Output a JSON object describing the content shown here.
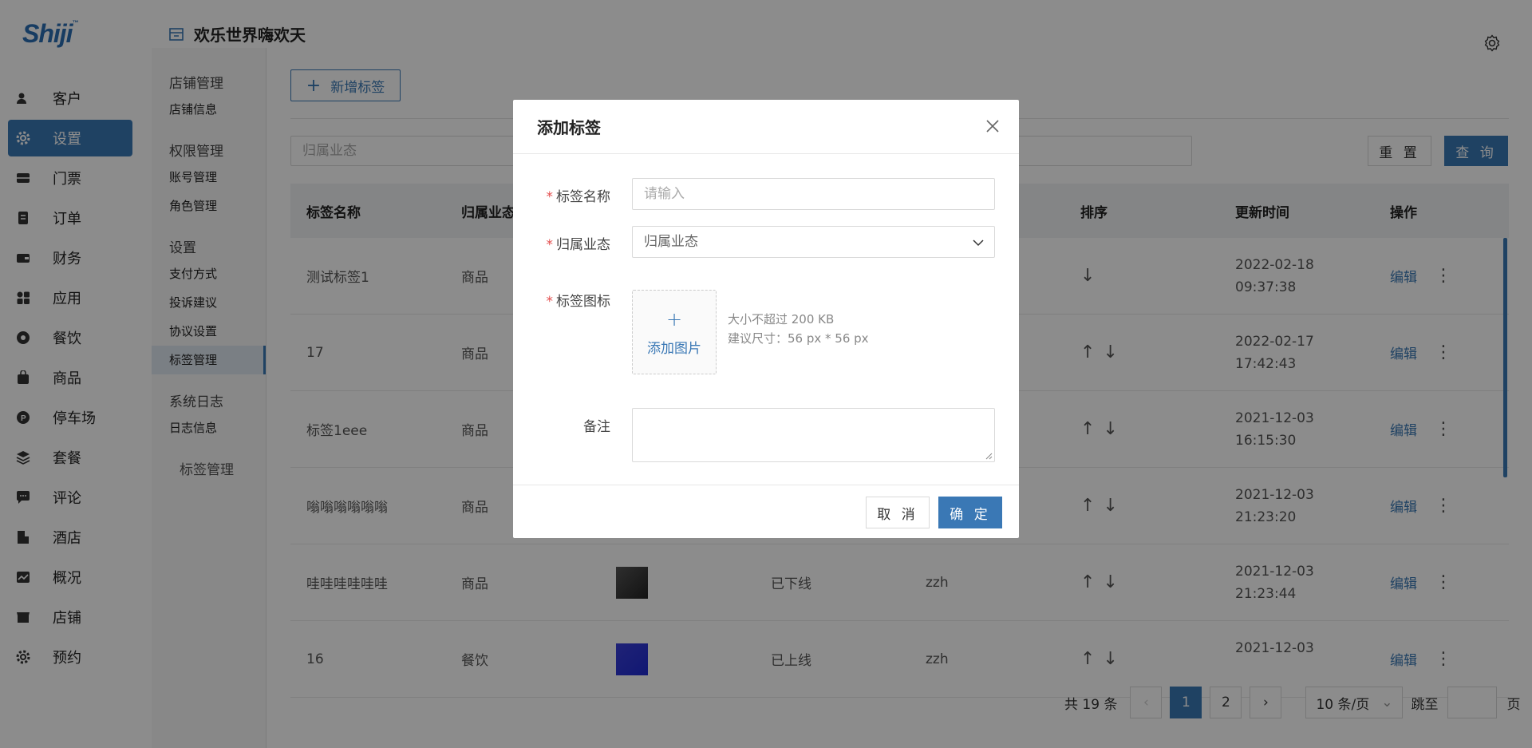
{
  "app": {
    "logo": "Shiji",
    "logo_mark": "™",
    "store_name": "欢乐世界嗨欢天"
  },
  "sidebar": {
    "items": [
      {
        "label": "客户",
        "icon": "user-icon"
      },
      {
        "label": "设置",
        "icon": "gear-icon",
        "active": true
      },
      {
        "label": "门票",
        "icon": "ticket-icon"
      },
      {
        "label": "订单",
        "icon": "order-icon"
      },
      {
        "label": "财务",
        "icon": "wallet-icon"
      },
      {
        "label": "应用",
        "icon": "apps-icon"
      },
      {
        "label": "餐饮",
        "icon": "dining-icon"
      },
      {
        "label": "商品",
        "icon": "bag-icon"
      },
      {
        "label": "停车场",
        "icon": "parking-icon"
      },
      {
        "label": "套餐",
        "icon": "layers-icon"
      },
      {
        "label": "评论",
        "icon": "comment-icon"
      },
      {
        "label": "酒店",
        "icon": "hotel-icon"
      },
      {
        "label": "概况",
        "icon": "chart-icon"
      },
      {
        "label": "店铺",
        "icon": "store-icon"
      },
      {
        "label": "预约",
        "icon": "gear-icon"
      }
    ]
  },
  "submenu": {
    "groups": [
      {
        "title": "店铺管理",
        "items": [
          "店铺信息"
        ]
      },
      {
        "title": "权限管理",
        "items": [
          "账号管理",
          "角色管理"
        ]
      },
      {
        "title": "设置",
        "items": [
          "支付方式",
          "投诉建议",
          "协议设置",
          "标签管理"
        ]
      },
      {
        "title": "系统日志",
        "items": [
          "日志信息"
        ]
      }
    ],
    "active_item": "标签管理",
    "extra": "标签管理"
  },
  "toolbar": {
    "add_label": "新增标签",
    "filter_placeholder": "归属业态",
    "reset_label": "重 置",
    "query_label": "查 询"
  },
  "table": {
    "headers": [
      "标签名称",
      "归属业态",
      "",
      "",
      "",
      "排序",
      "更新时间",
      "操作"
    ],
    "rows": [
      {
        "name": "测试标签1",
        "biz": "商品",
        "status": "",
        "user": "",
        "date": "2022-02-18",
        "time": "09:37:38",
        "up": false,
        "down": true,
        "thumb": ""
      },
      {
        "name": "17",
        "biz": "商品",
        "status": "",
        "user": "",
        "date": "2022-02-17",
        "time": "17:42:43",
        "up": true,
        "down": true,
        "thumb": ""
      },
      {
        "name": "标签1eee",
        "biz": "商品",
        "status": "",
        "user": "",
        "date": "2021-12-03",
        "time": "16:15:30",
        "up": true,
        "down": true,
        "thumb": ""
      },
      {
        "name": "嗡嗡嗡嗡嗡嗡",
        "biz": "商品",
        "status": "",
        "user": "",
        "date": "2021-12-03",
        "time": "21:23:20",
        "up": true,
        "down": true,
        "thumb": ""
      },
      {
        "name": "哇哇哇哇哇哇",
        "biz": "商品",
        "status": "已下线",
        "user": "zzh",
        "date": "2021-12-03",
        "time": "21:23:44",
        "up": true,
        "down": true,
        "thumb": "dark"
      },
      {
        "name": "16",
        "biz": "餐饮",
        "status": "已上线",
        "user": "zzh",
        "date": "2021-12-03",
        "time": "",
        "up": true,
        "down": true,
        "thumb": "blue"
      }
    ],
    "edit_label": "编辑"
  },
  "pagination": {
    "total": "共 19 条",
    "pages": [
      "1",
      "2"
    ],
    "current": "1",
    "size": "10 条/页",
    "jump_label": "跳至",
    "page_suffix": "页"
  },
  "modal": {
    "title": "添加标签",
    "fields": {
      "name_label": "标签名称",
      "name_placeholder": "请输入",
      "biz_label": "归属业态",
      "biz_value": "归属业态",
      "icon_label": "标签图标",
      "upload_label": "添加图片",
      "hint_size": "大小不超过 200 KB",
      "hint_dim": "建议尺寸：56 px * 56 px",
      "remark_label": "备注"
    },
    "cancel_label": "取 消",
    "ok_label": "确 定"
  },
  "colors": {
    "accent": "#3a78b5",
    "required": "#e34d4d"
  }
}
